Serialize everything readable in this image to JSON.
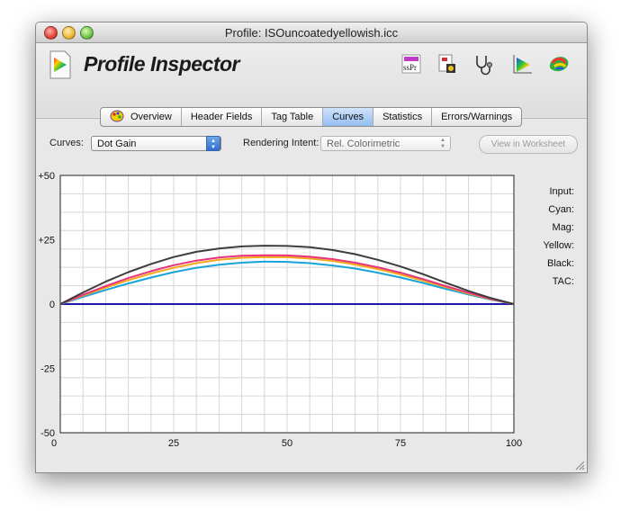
{
  "window": {
    "title": "Profile: ISOuncoatedyellowish.icc"
  },
  "app": {
    "title": "Profile Inspector"
  },
  "toolbar": {
    "tools": [
      "colorsync-utility-icon",
      "document-script-icon",
      "stethoscope-icon",
      "gamut-plot-icon",
      "color-palette-icon"
    ]
  },
  "tabs": [
    "Overview",
    "Header Fields",
    "Tag Table",
    "Curves",
    "Statistics",
    "Errors/Warnings"
  ],
  "active_tab": "Curves",
  "curves": {
    "label": "Curves:",
    "value": "Dot Gain"
  },
  "rendering": {
    "label": "Rendering Intent:",
    "value": "Rel. Colorimetric"
  },
  "worksheet_button": "View in Worksheet",
  "readouts": {
    "input": "Input:",
    "cyan": "Cyan:",
    "mag": "Mag:",
    "yellow": "Yellow:",
    "black": "Black:",
    "tac": "TAC:"
  },
  "colors": {
    "cyan": "#1aa3d8",
    "magenta": "#e8327c",
    "yellow": "#f2a91c",
    "black": "#3d3d3d",
    "baseline": "#1a1aa8"
  },
  "chart_data": {
    "type": "line",
    "title": "",
    "xlabel": "",
    "ylabel": "",
    "xlim": [
      0,
      100
    ],
    "ylim": [
      -50,
      50
    ],
    "x_ticks": [
      "0",
      "25",
      "50",
      "75",
      "100"
    ],
    "y_ticks": [
      "+50",
      "+25",
      "0",
      "-25",
      "-50"
    ],
    "grid": true,
    "x": [
      0,
      5,
      10,
      15,
      20,
      25,
      30,
      35,
      40,
      45,
      50,
      55,
      60,
      65,
      70,
      75,
      80,
      85,
      90,
      95,
      100
    ],
    "series": [
      {
        "color": "#3d3d3d",
        "values": [
          0,
          4.5,
          8.7,
          12.4,
          15.6,
          18.3,
          20.3,
          21.6,
          22.4,
          22.7,
          22.6,
          22.1,
          21.0,
          19.4,
          17.2,
          14.6,
          11.6,
          8.3,
          5.1,
          2.3,
          0
        ]
      },
      {
        "color": "#e8327c",
        "values": [
          0,
          3.6,
          7.0,
          10.1,
          12.8,
          15.1,
          16.9,
          18.1,
          18.8,
          19.0,
          18.9,
          18.4,
          17.5,
          16.1,
          14.3,
          12.2,
          9.7,
          7.0,
          4.4,
          2.0,
          0
        ]
      },
      {
        "color": "#f2a91c",
        "values": [
          0,
          3.3,
          6.4,
          9.3,
          11.9,
          14.1,
          15.9,
          17.2,
          18.0,
          18.3,
          18.2,
          17.7,
          16.8,
          15.4,
          13.6,
          11.5,
          9.1,
          6.6,
          4.1,
          1.9,
          0
        ]
      },
      {
        "color": "#1aa3d8",
        "values": [
          0,
          2.8,
          5.5,
          8.0,
          10.3,
          12.4,
          14.1,
          15.3,
          16.1,
          16.5,
          16.4,
          15.9,
          15.0,
          13.8,
          12.2,
          10.3,
          8.2,
          5.9,
          3.7,
          1.7,
          0
        ]
      },
      {
        "color": "#1a1aa8",
        "values": [
          0,
          0,
          0,
          0,
          0,
          0,
          0,
          0,
          0,
          0,
          0,
          0,
          0,
          0,
          0,
          0,
          0,
          0,
          0,
          0,
          0
        ]
      }
    ]
  }
}
